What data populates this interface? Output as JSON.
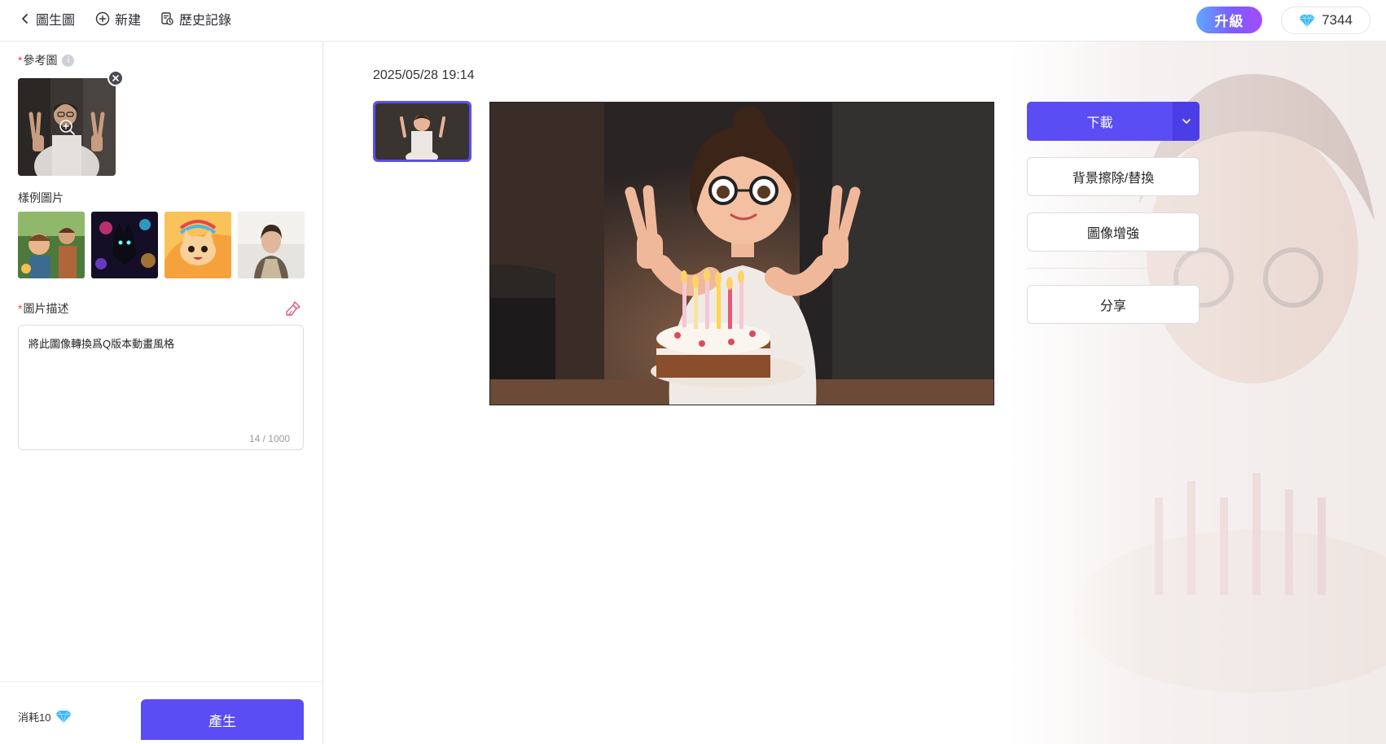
{
  "topbar": {
    "back_label": "圖生圖",
    "new_label": "新建",
    "history_label": "歷史記錄",
    "upgrade_label": "升級",
    "credits": "7344"
  },
  "left": {
    "reference_label": "參考圖",
    "samples_label": "樣例圖片",
    "description_label": "圖片描述",
    "description_value": "將此圖像轉換爲Q版本動畫風格",
    "description_count": "14 / 1000",
    "cost_label": "消耗10",
    "generate_label": "產生"
  },
  "main": {
    "timestamp": "2025/05/28 19:14",
    "download_label": "下載",
    "bg_remove_label": "背景擦除/替換",
    "enhance_label": "圖像增強",
    "share_label": "分享"
  },
  "icons": {
    "back": "chevron-left-icon",
    "new": "plus-circle-icon",
    "history": "history-icon",
    "credits": "diamond-icon",
    "info": "info-icon",
    "close": "close-icon",
    "zoom": "zoom-in-icon",
    "brush": "brush-icon",
    "dropdown": "chevron-down-icon"
  },
  "colors": {
    "accent": "#5b4df4",
    "required": "#e64545",
    "diamond": "#3bb8f5"
  }
}
